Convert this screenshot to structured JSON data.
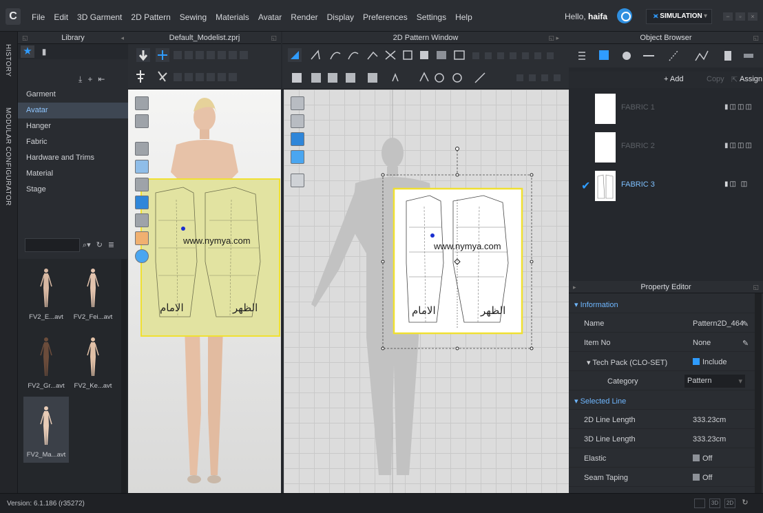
{
  "menubar": {
    "logo": "C",
    "menus": [
      "File",
      "Edit",
      "3D Garment",
      "2D Pattern",
      "Sewing",
      "Materials",
      "Avatar",
      "Render",
      "Display",
      "Preferences",
      "Settings",
      "Help"
    ],
    "greeting_prefix": "Hello, ",
    "user_name": "haifa",
    "mode_label": "SIMULATION",
    "window_controls": [
      "−",
      "▫",
      "×"
    ]
  },
  "side_tabs": [
    "HISTORY",
    "MODULAR CONFIGURATOR"
  ],
  "library": {
    "title": "Library",
    "categories": [
      "Garment",
      "Avatar",
      "Hanger",
      "Fabric",
      "Hardware and Trims",
      "Material",
      "Stage"
    ],
    "selected_category": "Avatar",
    "search_value": "",
    "thumbnails": [
      "FV2_E...avt",
      "FV2_Fei...avt",
      "FV2_Gr...avt",
      "FV2_Ke...avt",
      "FV2_Ma...avt"
    ]
  },
  "view3d": {
    "title": "Default_Modelist.zprj"
  },
  "view2d": {
    "title": "2D Pattern Window"
  },
  "pattern": {
    "watermark": "www.nymya.com",
    "front_label": "الامام",
    "back_label": "الظهر"
  },
  "object_browser": {
    "title": "Object Browser",
    "add_label": "+ Add",
    "copy_label": "Copy",
    "assign_label": "Assign",
    "fabrics": [
      {
        "name": "FABRIC 1",
        "selected": false
      },
      {
        "name": "FABRIC 2",
        "selected": false
      },
      {
        "name": "FABRIC 3",
        "selected": true
      }
    ]
  },
  "property_editor": {
    "title": "Property Editor",
    "information_label": "Information",
    "name_label": "Name",
    "name_value": "Pattern2D_464",
    "item_no_label": "Item No",
    "item_no_value": "None",
    "tech_pack_label": "Tech Pack (CLO-SET)",
    "tech_pack_value": "Include",
    "category_label": "Category",
    "category_value": "Pattern",
    "selected_line_label": "Selected Line",
    "line2d_label": "2D Line Length",
    "line2d_value": "333.23cm",
    "line3d_label": "3D Line Length",
    "line3d_value": "333.23cm",
    "elastic_label": "Elastic",
    "elastic_value": "Off",
    "seam_label": "Seam Taping",
    "seam_value": "Off"
  },
  "statusbar": {
    "version": "Version: 6.1.186 (r35272)"
  },
  "colors": {
    "accent": "#2f9cff",
    "pattern_yellow": "#e2e3a1",
    "selection_blue": "#7fc1ff"
  }
}
